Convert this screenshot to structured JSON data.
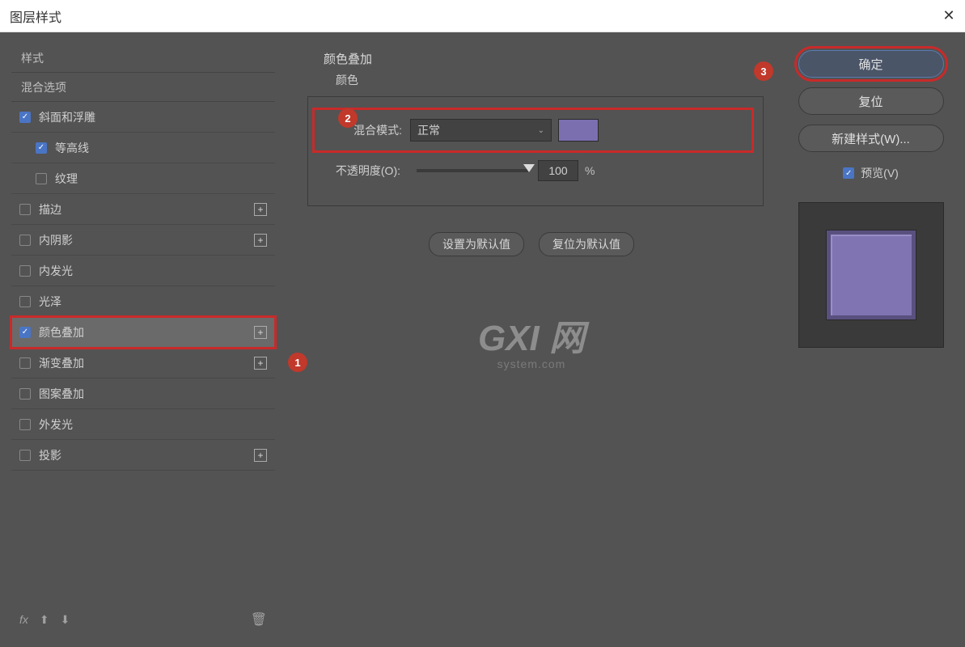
{
  "window": {
    "title": "图层样式"
  },
  "sidebar": {
    "header_styles": "样式",
    "header_blend": "混合选项",
    "items": [
      {
        "label": "斜面和浮雕",
        "checked": true,
        "indent": false,
        "plus": false
      },
      {
        "label": "等高线",
        "checked": true,
        "indent": true,
        "plus": false
      },
      {
        "label": "纹理",
        "checked": false,
        "indent": true,
        "plus": false
      },
      {
        "label": "描边",
        "checked": false,
        "indent": false,
        "plus": true
      },
      {
        "label": "内阴影",
        "checked": false,
        "indent": false,
        "plus": true
      },
      {
        "label": "内发光",
        "checked": false,
        "indent": false,
        "plus": false
      },
      {
        "label": "光泽",
        "checked": false,
        "indent": false,
        "plus": false
      },
      {
        "label": "颜色叠加",
        "checked": true,
        "indent": false,
        "plus": true,
        "selected": true
      },
      {
        "label": "渐变叠加",
        "checked": false,
        "indent": false,
        "plus": true
      },
      {
        "label": "图案叠加",
        "checked": false,
        "indent": false,
        "plus": false
      },
      {
        "label": "外发光",
        "checked": false,
        "indent": false,
        "plus": false
      },
      {
        "label": "投影",
        "checked": false,
        "indent": false,
        "plus": true
      }
    ],
    "fx": "fx"
  },
  "panel": {
    "title": "颜色叠加",
    "subtitle": "颜色",
    "blend_label": "混合模式:",
    "blend_value": "正常",
    "color": "#7b6fb0",
    "opacity_label": "不透明度(O):",
    "opacity_value": "100",
    "opacity_unit": "%",
    "set_default": "设置为默认值",
    "reset_default": "复位为默认值"
  },
  "buttons": {
    "ok": "确定",
    "cancel": "复位",
    "new_style": "新建样式(W)...",
    "preview": "预览(V)"
  },
  "watermark": {
    "big": "GXI 网",
    "small": "system.com"
  },
  "markers": {
    "m1": "1",
    "m2": "2",
    "m3": "3"
  }
}
